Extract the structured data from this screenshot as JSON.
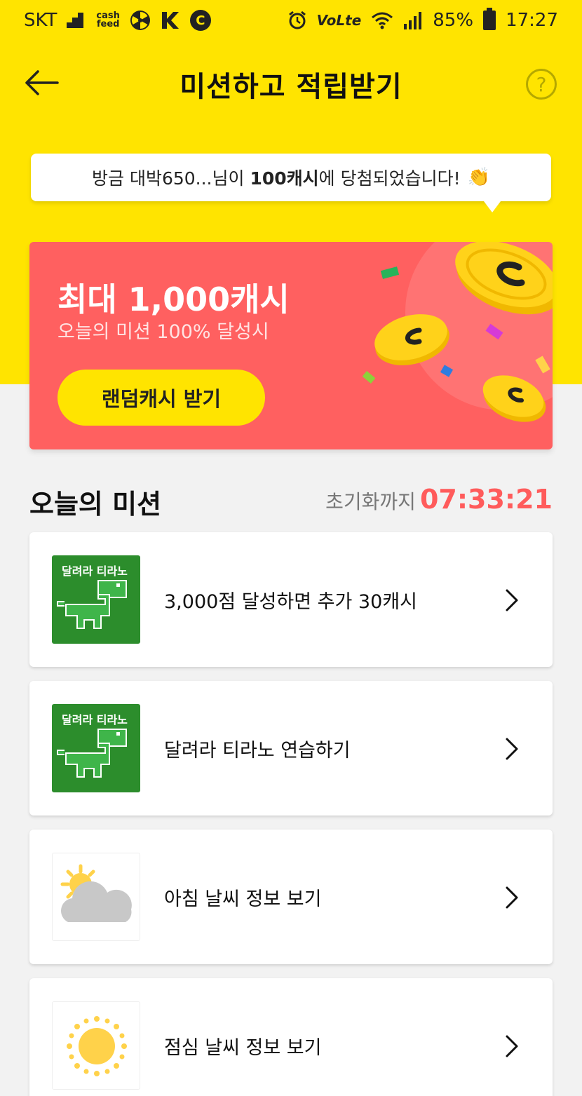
{
  "status_bar": {
    "carrier": "SKT",
    "cashfeed": "cash feed",
    "network": "VoLte",
    "battery": "85%",
    "time": "17:27"
  },
  "header": {
    "title": "미션하고 적립받기",
    "help_label": "?"
  },
  "notice": {
    "prefix": "방금 대박650...님이 ",
    "amount": "100캐시",
    "suffix": "에 당첨되었습니다!",
    "emoji": "👏"
  },
  "promo": {
    "title": "최대 1,000캐시",
    "subtitle": "오늘의 미션 100% 달성시",
    "button_label": "랜덤캐시 받기"
  },
  "missions_section": {
    "title": "오늘의 미션",
    "timer_label": "초기화까지",
    "timer_value": "07:33:21"
  },
  "missions": [
    {
      "label": "3,000점 달성하면 추가 30캐시",
      "thumb": "dino",
      "thumb_text": "달려라 티라노"
    },
    {
      "label": "달려라 티라노 연습하기",
      "thumb": "dino",
      "thumb_text": "달려라 티라노"
    },
    {
      "label": "아침 날씨 정보 보기",
      "thumb": "sun-cloud"
    },
    {
      "label": "점심 날씨 정보 보기",
      "thumb": "sun"
    }
  ],
  "colors": {
    "brand_yellow": "#ffe400",
    "promo_red": "#ff6060",
    "timer_red": "#ff5b5b",
    "dino_green": "#2c8d2c"
  }
}
